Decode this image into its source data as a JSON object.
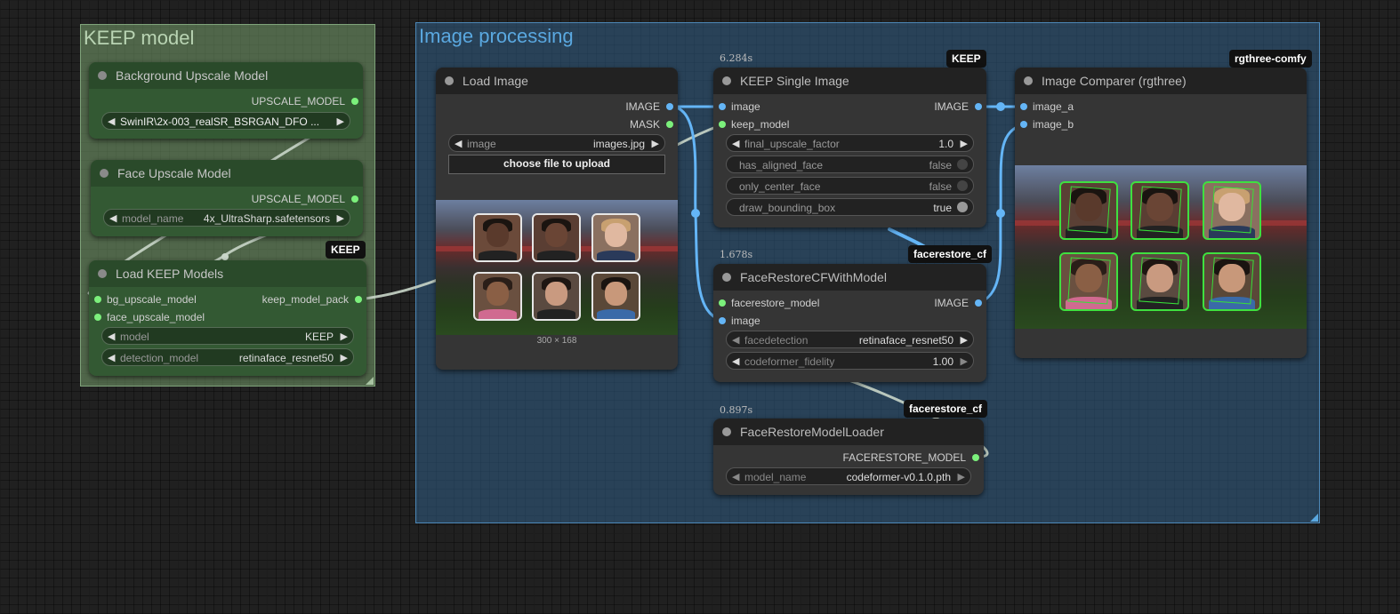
{
  "groups": {
    "keep": {
      "title": "KEEP model"
    },
    "image": {
      "title": "Image processing"
    }
  },
  "nodes": {
    "bg_upscale": {
      "title": "Background Upscale Model",
      "output": "UPSCALE_MODEL",
      "model_value": "SwinIR\\2x-003_realSR_BSRGAN_DFO ..."
    },
    "face_upscale": {
      "title": "Face Upscale Model",
      "output": "UPSCALE_MODEL",
      "model_label": "model_name",
      "model_value": "4x_UltraSharp.safetensors"
    },
    "load_keep": {
      "title": "Load KEEP Models",
      "badge": "KEEP",
      "inputs": [
        "bg_upscale_model",
        "face_upscale_model"
      ],
      "output": "keep_model_pack",
      "widgets": [
        {
          "label": "model",
          "value": "KEEP"
        },
        {
          "label": "detection_model",
          "value": "retinaface_resnet50"
        }
      ]
    },
    "load_image": {
      "title": "Load Image",
      "outputs": [
        "IMAGE",
        "MASK"
      ],
      "image_label": "image",
      "image_value": "images.jpg",
      "upload_label": "choose file to upload",
      "dims": "300 × 168"
    },
    "keep_single": {
      "title": "KEEP Single Image",
      "timing": "6.284s",
      "badge": "KEEP",
      "inputs": [
        "image",
        "keep_model"
      ],
      "output": "IMAGE",
      "widgets": [
        {
          "label": "final_upscale_factor",
          "value": "1.0"
        },
        {
          "label": "has_aligned_face",
          "value": "false"
        },
        {
          "label": "only_center_face",
          "value": "false"
        },
        {
          "label": "draw_bounding_box",
          "value": "true"
        }
      ]
    },
    "facerestore_cf": {
      "title": "FaceRestoreCFWithModel",
      "timing": "1.678s",
      "badge": "facerestore_cf",
      "inputs": [
        "facerestore_model",
        "image"
      ],
      "output": "IMAGE",
      "widgets": [
        {
          "label": "facedetection",
          "value": "retinaface_resnet50"
        },
        {
          "label": "codeformer_fidelity",
          "value": "1.00"
        }
      ]
    },
    "facerestore_loader": {
      "title": "FaceRestoreModelLoader",
      "timing": "0.897s",
      "badge": "facerestore_cf",
      "output": "FACERESTORE_MODEL",
      "model_label": "model_name",
      "model_value": "codeformer-v0.1.0.pth"
    },
    "image_comparer": {
      "title": "Image Comparer (rgthree)",
      "badge": "rgthree-comfy",
      "inputs": [
        "image_a",
        "image_b"
      ]
    }
  },
  "colors": {
    "image_link": "#64b5f6",
    "model_link": "#c9d6c9",
    "keep_group": "#7fa37a",
    "image_group": "#4c87b7"
  }
}
